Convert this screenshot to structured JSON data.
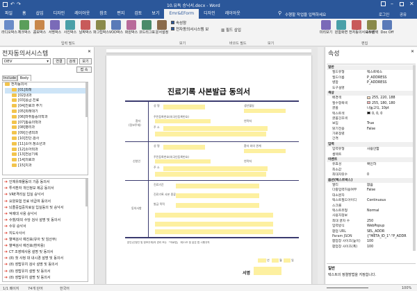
{
  "window": {
    "title": "10.유독 승낙서.docx - Word",
    "search": "수행할 작업을 입력하세요",
    "login": "로그인",
    "share": "공유"
  },
  "tabs": [
    "파일",
    "홈",
    "삽입",
    "디자인",
    "레이아웃",
    "참조",
    "편지",
    "검토",
    "보기",
    "Emr&EForm",
    "디자인",
    "레이아웃"
  ],
  "active_tab": 9,
  "ribbon": {
    "buttons": [
      "라디오박스",
      "체크박스",
      "콤보박스",
      "서명박스",
      "사진박스",
      "날짜박스",
      "파그립박스",
      "VOD박스",
      "화원박스",
      "코드리그표",
      "문서설정"
    ],
    "checks": [
      "속성창",
      "전자동의서시스템 보"
    ],
    "bar_label": "필드 삽입",
    "right_buttons": [
      "미리보기",
      "원함화면",
      "전자동의서시스템",
      "모두선택",
      "Doc Off"
    ],
    "groups": [
      "입력 필드",
      "보기",
      "바코드 필드",
      "보기",
      "편집"
    ]
  },
  "left_pane": {
    "title": "전자동의서시스템",
    "db": "DEV",
    "btn_connect": "연결",
    "btn_search": "검색",
    "btn_view": "보기",
    "btn_out": "접 속",
    "tabs": [
      "Include",
      "Body"
    ],
    "tree": [
      "전자동의서",
      "[01]외래",
      "[02]내과",
      "[03]응급.진료",
      "[04]진료과 주기",
      "[05]외래대기",
      "[06]마취통증의학과",
      "[07]통증의학과",
      "[08]병리과",
      "[09]신경외과",
      "[10]진단.검사",
      "[11]소아.청소년과",
      "[12]소아외과",
      "[13]전문기록",
      "[14]의료과",
      "[15]치과"
    ],
    "list": [
      "인체유래물동의 기증 동의서",
      "투석환자 개인정보 제공 동의서",
      "VRE격리실 입실 승낙서",
      "요양보험 진료 비급여 동의서",
      "뇌졸중집중치료실 입실동의 및 승낙서",
      "억제대 사용 승낙서",
      "수혈/대외 수당 검사 설명 및 동의서",
      "수유 승낙서",
      "지도사사서",
      "혈액검사 예진표(유아 및 임산부)",
      "혈액검사 예진표(환자용)",
      "CT 조영제사용 설명 및 동의서",
      "(8) 첫 사정 대 내시경 설명 및 동의서",
      "(8) 장탑유치 검사 설명 및 동의서",
      "(8) 장탑유치 설명 및 동의서",
      "(8) 장탑유치 설명 및 동의서"
    ]
  },
  "document": {
    "title": "진료기록 사본발급 동의서",
    "labels": [
      "성 명",
      "생년월일",
      "주민등록번호(외국인등록번호)",
      "주 소",
      "연락처",
      "신청인",
      "환자 와의 관계",
      "주 소",
      "연락처",
      "진료기간",
      "진료기록 사본 종류",
      "발급 목적",
      "의료기관",
      "환자"
    ],
    "side": [
      "환자",
      "(정보주체)",
      "신청인",
      "동의사항"
    ],
    "note": "본인(신청인 및 정보주체)의 권리 또는 「의료법」 제21조 및 같은 법 시행규칙",
    "sign": "서명",
    "date_parts": [
      "년",
      "월",
      "일"
    ]
  },
  "right_pane": {
    "title": "속성",
    "rows": [
      {
        "k": "일반",
        "v": "",
        "cat": true
      },
      {
        "k": "필드유형",
        "v": "텍스트박스"
      },
      {
        "k": "필드이름",
        "v": "P_ADDRESS"
      },
      {
        "k": "병합",
        "v": "P_ADDRESS"
      },
      {
        "k": "도구설명",
        "v": ""
      },
      {
        "k": "색상",
        "v": "",
        "cat": true
      },
      {
        "k": "배경색",
        "v": "255, 220, 188"
      },
      {
        "k": "필수항목색",
        "v": "255, 180, 180"
      },
      {
        "k": "글꼴",
        "v": "나눔고딕, 10pt"
      },
      {
        "k": "텍스트색",
        "v": "0, 0, 0"
      },
      {
        "k": "글꼴강조색",
        "v": ""
      },
      {
        "k": "보임",
        "v": "True"
      },
      {
        "k": "읽기전용",
        "v": "False"
      },
      {
        "k": "가로정렬",
        "v": ""
      },
      {
        "k": "간격",
        "v": ""
      },
      {
        "k": "입력",
        "v": "",
        "cat": true
      },
      {
        "k": "입력유형",
        "v": "사용안함"
      },
      {
        "k": "셀렉트",
        "v": ""
      },
      {
        "k": "이벤트",
        "v": "",
        "cat": true
      },
      {
        "k": "유효성",
        "v": "확인하"
      },
      {
        "k": "최소값",
        "v": ""
      },
      {
        "k": "최대자릿수",
        "v": "0"
      },
      {
        "k": "옵션(텍스트박스)",
        "v": "",
        "cat": true
      },
      {
        "k": "멀티",
        "v": "없음"
      },
      {
        "k": "다중입력허용여부",
        "v": "False"
      },
      {
        "k": "대소문자",
        "v": ""
      },
      {
        "k": "텍스트필드아이디",
        "v": "Continuous"
      },
      {
        "k": "스크롤",
        "v": ""
      },
      {
        "k": "텍스트유형",
        "v": "Normal"
      },
      {
        "k": "사용자정보",
        "v": ""
      },
      {
        "k": "최대 글자 수",
        "v": "250"
      },
      {
        "k": "입력방식",
        "v": "WebPopup"
      },
      {
        "k": "팝업 URL",
        "v": "SEL_ADDR"
      },
      {
        "k": "Param JSON",
        "v": "{\"META_ID_1\":\"P_ADDR"
      },
      {
        "k": "팝업창 사이즈(높이)",
        "v": "100"
      },
      {
        "k": "팝업창 사이즈(폭)",
        "v": "100"
      }
    ],
    "footer_title": "일반",
    "footer_text": "텍스트의 정렬방법을 지정합니다."
  },
  "status": {
    "page": "1/1 페이지",
    "words": "74개 단어",
    "lang": "한국어",
    "zoom": "100%"
  },
  "colors": {
    "brand": "#2b579a",
    "field": "#fdf0a0",
    "doc_line": "#3a3a6e"
  }
}
